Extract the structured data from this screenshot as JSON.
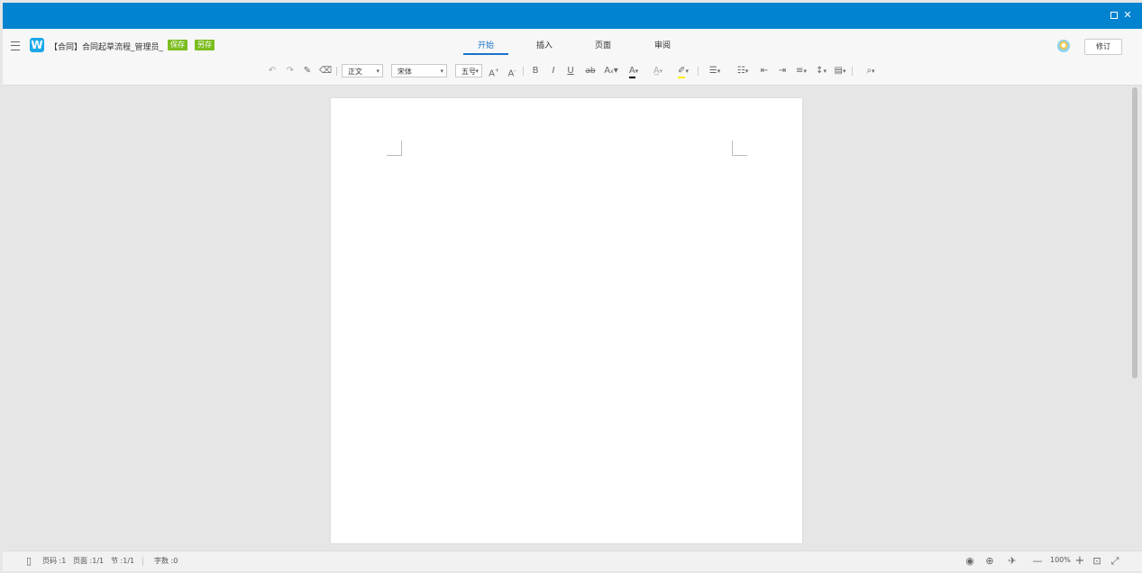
{
  "window": {
    "maximize_icon": "maximize-icon",
    "close_glyph": "✕"
  },
  "header": {
    "doc_title": "【合同】合同起草流程_管理员_",
    "save_label": "保存",
    "save_as_label": "另存",
    "tabs": [
      {
        "label": "开始",
        "active": true
      },
      {
        "label": "插入",
        "active": false
      },
      {
        "label": "页面",
        "active": false
      },
      {
        "label": "审阅",
        "active": false
      }
    ],
    "revise_label": "修订"
  },
  "toolbar": {
    "style_value": "正文",
    "font_value": "宋体",
    "size_value": "五号",
    "bold": "B",
    "italic": "I",
    "underline": "U",
    "strike": "ab",
    "font_color_glyph": "A",
    "font_color": "#000000",
    "highlight_color": "#ffee00",
    "accent": "#1a73c8"
  },
  "statusbar": {
    "page_code": "页码 :1",
    "page_count": "页面 :1/1",
    "section": "节 :1/1",
    "word_count": "字数 :0",
    "zoom": "100%"
  },
  "colors": {
    "titlebar": "#0283d0",
    "tag": "#7cbd1f"
  }
}
